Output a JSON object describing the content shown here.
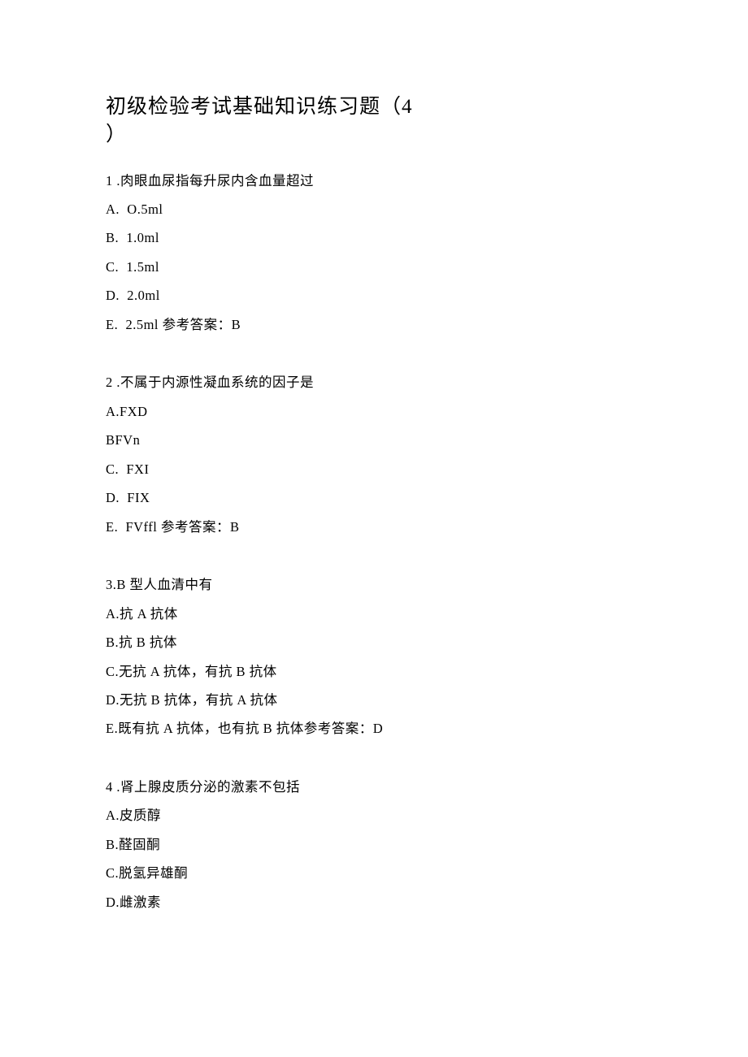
{
  "title_line1": "初级检验考试基础知识练习题（4",
  "title_line2": "）",
  "q1": {
    "stem": "1 .肉眼血尿指每升尿内含血量超过",
    "a": "A.  O.5ml",
    "b": "B.  1.0ml",
    "c": "C.  1.5ml",
    "d": "D.  2.0ml",
    "e": "E.  2.5ml 参考答案：B"
  },
  "q2": {
    "stem": "2 .不属于内源性凝血系统的因子是",
    "a": "A.FXD",
    "b": "BFVn",
    "c": "C.  FXI",
    "d": "D.  FIX",
    "e": "E.  FVffl 参考答案：B"
  },
  "q3": {
    "stem": "3.B 型人血清中有",
    "a": "A.抗 A 抗体",
    "b": "B.抗 B 抗体",
    "c": "C.无抗 A 抗体，有抗 B 抗体",
    "d": "D.无抗 B 抗体，有抗 A 抗体",
    "e": "E.既有抗 A 抗体，也有抗 B 抗体参考答案：D"
  },
  "q4": {
    "stem": "4 .肾上腺皮质分泌的激素不包括",
    "a": "A.皮质醇",
    "b": "B.醛固酮",
    "c": "C.脱氢异雄酮",
    "d": "D.雌激素"
  }
}
